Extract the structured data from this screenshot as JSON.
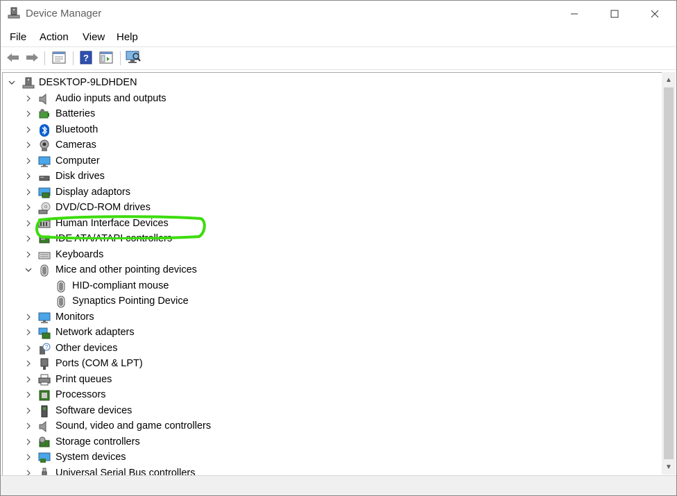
{
  "window": {
    "title": "Device Manager",
    "minimize_glyph": "—",
    "maximize_glyph": "☐",
    "close_glyph": "✕"
  },
  "menu": [
    "File",
    "Action",
    "View",
    "Help"
  ],
  "toolbar": {
    "icons": [
      "back-arrow-icon",
      "forward-arrow-icon",
      "properties-icon",
      "help-icon",
      "show-hide-console-tree-icon",
      "scan-hardware-changes-icon"
    ]
  },
  "tree": {
    "root": {
      "label": "DESKTOP-9LDHDEN",
      "icon": "computer-tower-icon",
      "expanded": true
    },
    "items": [
      {
        "label": "Audio inputs and outputs",
        "icon": "speaker-icon",
        "expanded": false
      },
      {
        "label": "Batteries",
        "icon": "battery-icon",
        "expanded": false
      },
      {
        "label": "Bluetooth",
        "icon": "bluetooth-icon",
        "expanded": false
      },
      {
        "label": "Cameras",
        "icon": "camera-icon",
        "expanded": false
      },
      {
        "label": "Computer",
        "icon": "monitor-icon",
        "expanded": false
      },
      {
        "label": "Disk drives",
        "icon": "disk-drive-icon",
        "expanded": false
      },
      {
        "label": "Display adaptors",
        "icon": "display-adapter-icon",
        "expanded": false
      },
      {
        "label": "DVD/CD-ROM drives",
        "icon": "dvd-icon",
        "expanded": false
      },
      {
        "label": "Human Interface Devices",
        "icon": "hid-icon",
        "expanded": false
      },
      {
        "label": "IDE ATA/ATAPI controllers",
        "icon": "ide-controller-icon",
        "expanded": false
      },
      {
        "label": "Keyboards",
        "icon": "keyboard-icon",
        "expanded": false
      },
      {
        "label": "Mice and other pointing devices",
        "icon": "mouse-icon",
        "expanded": true,
        "children": [
          {
            "label": "HID-compliant mouse",
            "icon": "mouse-icon"
          },
          {
            "label": "Synaptics Pointing Device",
            "icon": "mouse-icon"
          }
        ]
      },
      {
        "label": "Monitors",
        "icon": "monitor-icon",
        "expanded": false
      },
      {
        "label": "Network adapters",
        "icon": "network-adapter-icon",
        "expanded": false
      },
      {
        "label": "Other devices",
        "icon": "unknown-device-icon",
        "expanded": false
      },
      {
        "label": "Ports (COM & LPT)",
        "icon": "port-icon",
        "expanded": false
      },
      {
        "label": "Print queues",
        "icon": "printer-icon",
        "expanded": false
      },
      {
        "label": "Processors",
        "icon": "processor-icon",
        "expanded": false
      },
      {
        "label": "Software devices",
        "icon": "software-device-icon",
        "expanded": false
      },
      {
        "label": "Sound, video and game controllers",
        "icon": "speaker-icon",
        "expanded": false
      },
      {
        "label": "Storage controllers",
        "icon": "storage-controller-icon",
        "expanded": false
      },
      {
        "label": "System devices",
        "icon": "system-device-icon",
        "expanded": false
      },
      {
        "label": "Universal Serial Bus controllers",
        "icon": "usb-icon",
        "expanded": false
      }
    ]
  },
  "annotation": {
    "color": "#3ddc0e",
    "target": "Synaptics Pointing Device"
  },
  "colors": {
    "accent": "#0078d7",
    "bluetooth": "#0a5fd0"
  }
}
